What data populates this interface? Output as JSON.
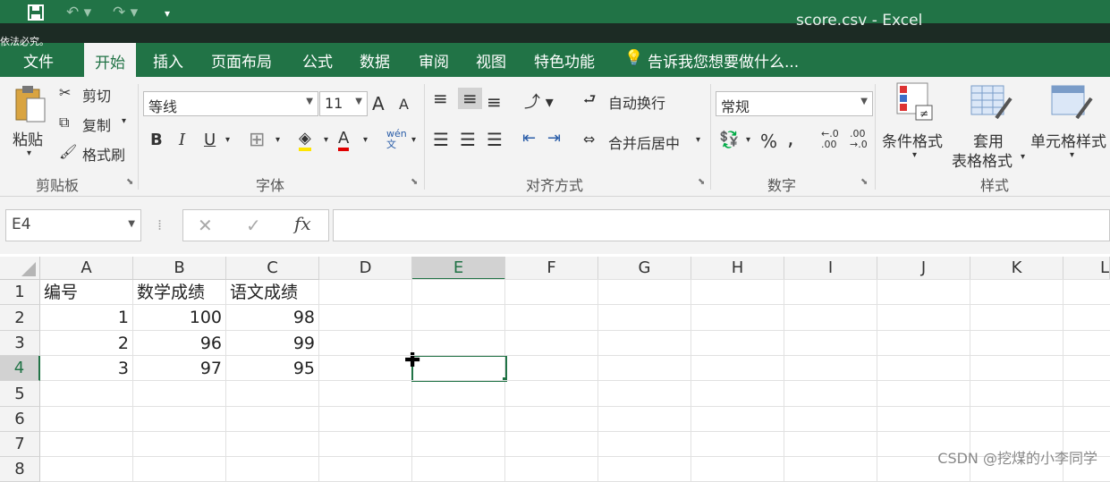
{
  "window": {
    "title": "score.csv - Excel"
  },
  "overlay_text": "依法必究。",
  "quick_access": {
    "save_icon": "save-icon",
    "undo_icon": "undo-icon",
    "redo_icon": "redo-icon",
    "customize_icon": "customize-icon"
  },
  "tabs": [
    "文件",
    "开始",
    "插入",
    "页面布局",
    "公式",
    "数据",
    "审阅",
    "视图",
    "特色功能"
  ],
  "active_tab": "开始",
  "tell_me": "告诉我您想要做什么...",
  "ribbon": {
    "clipboard": {
      "paste": "粘贴",
      "cut": "剪切",
      "copy": "复制",
      "format_painter": "格式刷",
      "label": "剪贴板"
    },
    "font": {
      "font_name": "等线",
      "font_size": "11",
      "grow": "A",
      "shrink": "A",
      "bold": "B",
      "italic": "I",
      "underline": "U",
      "font_color": "A",
      "phonetic": "wén\n文",
      "label": "字体"
    },
    "alignment": {
      "wrap_text": "自动换行",
      "merge_center": "合并后居中",
      "label": "对齐方式"
    },
    "number": {
      "format": "常规",
      "percent": "%",
      "comma": ",",
      "inc_decimal": "←.0\n.00",
      "dec_decimal": ".00\n→.0",
      "label": "数字"
    },
    "styles": {
      "conditional": "条件格式",
      "table_format_1": "套用",
      "table_format_2": "表格格式",
      "cell_styles": "单元格样式",
      "label": "样式"
    }
  },
  "formula_bar": {
    "name_box": "E4",
    "cancel": "✕",
    "enter": "✓",
    "fx": "fx",
    "formula": ""
  },
  "sheet": {
    "columns": [
      "A",
      "B",
      "C",
      "D",
      "E",
      "F",
      "G",
      "H",
      "I",
      "J",
      "K",
      "L"
    ],
    "rows": [
      "1",
      "2",
      "3",
      "4",
      "5",
      "6",
      "7",
      "8"
    ],
    "selected_cell": "E4",
    "cells": [
      [
        "编号",
        "数学成绩",
        "语文成绩"
      ],
      [
        "1",
        "100",
        "98"
      ],
      [
        "2",
        "96",
        "99"
      ],
      [
        "3",
        "97",
        "95"
      ]
    ]
  },
  "watermark": "CSDN @挖煤的小李同学"
}
